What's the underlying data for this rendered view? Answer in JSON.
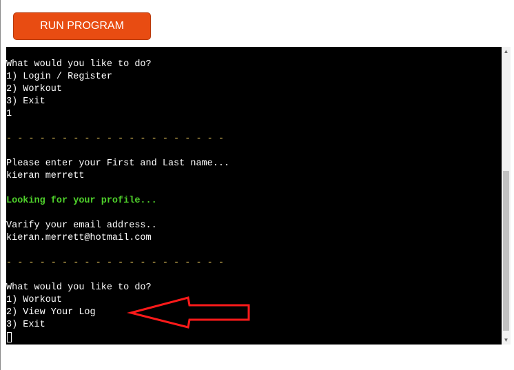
{
  "toolbar": {
    "run_label": "RUN PROGRAM",
    "run_color": "#e84c12"
  },
  "terminal": {
    "background": "#000000",
    "lines": [
      {
        "text": "What would you like to do?",
        "color": "white"
      },
      {
        "text": "1) Login / Register",
        "color": "white"
      },
      {
        "text": "2) Workout",
        "color": "white"
      },
      {
        "text": "3) Exit",
        "color": "white"
      },
      {
        "text": "1",
        "color": "white"
      },
      {
        "text": "",
        "color": "white"
      },
      {
        "text": "- - - - - - - - - - - - - - - - - - - -",
        "color": "yellow"
      },
      {
        "text": "",
        "color": "white"
      },
      {
        "text": "Please enter your First and Last name...",
        "color": "white"
      },
      {
        "text": "kieran merrett",
        "color": "white"
      },
      {
        "text": "",
        "color": "white"
      },
      {
        "text": "Looking for your profile...",
        "color": "green"
      },
      {
        "text": "",
        "color": "white"
      },
      {
        "text": "Varify your email address..",
        "color": "white"
      },
      {
        "text": "kieran.merrett@hotmail.com",
        "color": "white"
      },
      {
        "text": "",
        "color": "white"
      },
      {
        "text": "- - - - - - - - - - - - - - - - - - - -",
        "color": "yellow"
      },
      {
        "text": "",
        "color": "white"
      },
      {
        "text": "What would you like to do?",
        "color": "white"
      },
      {
        "text": "1) Workout",
        "color": "white"
      },
      {
        "text": "2) View Your Log",
        "color": "white"
      },
      {
        "text": "3) Exit",
        "color": "white"
      }
    ]
  },
  "scrollbar": {
    "up_icon": "triangle-up-icon",
    "down_icon": "triangle-down-icon",
    "up_glyph": "▲",
    "down_glyph": "▼"
  },
  "annotation": {
    "icon": "red-arrow-icon",
    "color": "#ff1a1a"
  }
}
